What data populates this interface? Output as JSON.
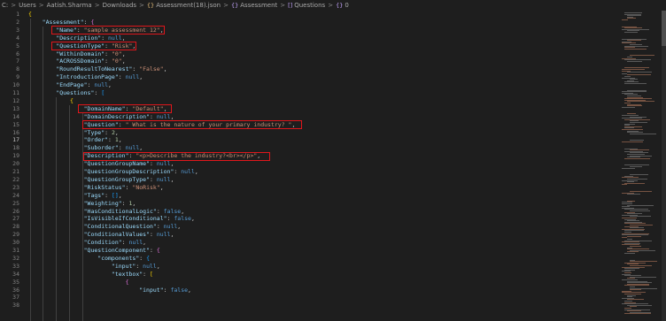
{
  "breadcrumb": {
    "items": [
      {
        "label": "C:",
        "icon": ""
      },
      {
        "label": "Users",
        "icon": ""
      },
      {
        "label": "Aatish.Sharma",
        "icon": ""
      },
      {
        "label": "Downloads",
        "icon": ""
      },
      {
        "label": "Assessment(18).json",
        "icon": "{}"
      },
      {
        "label": "Assessment",
        "icon": "{}"
      },
      {
        "label": "Questions",
        "icon": "[]"
      },
      {
        "label": "0",
        "icon": "{}"
      }
    ],
    "separator": ">"
  },
  "editor": {
    "active_line": 17,
    "lines": [
      {
        "n": "1"
      },
      {
        "n": "2"
      },
      {
        "n": "3"
      },
      {
        "n": "4"
      },
      {
        "n": "5"
      },
      {
        "n": "6"
      },
      {
        "n": "7"
      },
      {
        "n": "8"
      },
      {
        "n": "9"
      },
      {
        "n": "10"
      },
      {
        "n": "11"
      },
      {
        "n": "12"
      },
      {
        "n": "13"
      },
      {
        "n": "14"
      },
      {
        "n": "15"
      },
      {
        "n": "16"
      },
      {
        "n": "17"
      },
      {
        "n": "18"
      },
      {
        "n": "19"
      },
      {
        "n": "20"
      },
      {
        "n": "21"
      },
      {
        "n": "22"
      },
      {
        "n": "23"
      },
      {
        "n": "24"
      },
      {
        "n": "25"
      },
      {
        "n": "26"
      },
      {
        "n": "27"
      },
      {
        "n": "28"
      },
      {
        "n": "29"
      },
      {
        "n": "30"
      },
      {
        "n": "31"
      },
      {
        "n": "32"
      },
      {
        "n": "33"
      },
      {
        "n": "34"
      },
      {
        "n": "35"
      },
      {
        "n": "36"
      },
      {
        "n": "37"
      },
      {
        "n": "38"
      }
    ],
    "code": {
      "l2_key": "\"Assessment\"",
      "l3_key": "\"Name\"",
      "l3_val": "\"sample assessment 12\"",
      "l4_key": "\"Description\"",
      "l4_val": "null",
      "l5_key": "\"QuestionType\"",
      "l5_val": "\"Risk\"",
      "l6_key": "\"WithinDomain\"",
      "l6_val": "\"0\"",
      "l7_key": "\"ACROSSDomain\"",
      "l7_val": "\"0\"",
      "l8_key": "\"RoundResultToNearest\"",
      "l8_val": "\"False\"",
      "l9_key": "\"IntroductionPage\"",
      "l9_val": "null",
      "l10_key": "\"EndPage\"",
      "l10_val": "null",
      "l11_key": "\"Questions\"",
      "l13_key": "\"DomainName\"",
      "l13_val": "\"Default\"",
      "l14_key": "\"DomainDescription\"",
      "l14_val": "null",
      "l15_key": "\"Question\"",
      "l15_val": "\" What is the nature of your primary industry? \"",
      "l16_key": "\"Type\"",
      "l16_val": "2",
      "l17_key": "\"Order\"",
      "l17_val": "1",
      "l18_key": "\"Suborder\"",
      "l18_val": "null",
      "l19_key": "\"Description\"",
      "l19_val": "\"<p>Describe the industry?<br></p>\"",
      "l20_key": "\"QuestionGroupName\"",
      "l20_val": "null",
      "l21_key": "\"QuestionGroupDescription\"",
      "l21_val": "null",
      "l22_key": "\"QuestionGroupType\"",
      "l22_val": "null",
      "l23_key": "\"RiskStatus\"",
      "l23_val": "\"NoRisk\"",
      "l24_key": "\"Tags\"",
      "l24_val": "[]",
      "l25_key": "\"Weighting\"",
      "l25_val": "1",
      "l26_key": "\"HasConditionalLogic\"",
      "l26_val": "false",
      "l27_key": "\"IsVisibleIfConditional\"",
      "l27_val": "false",
      "l28_key": "\"ConditionalQuestion\"",
      "l28_val": "null",
      "l29_key": "\"ConditionalValues\"",
      "l29_val": "null",
      "l30_key": "\"Condition\"",
      "l30_val": "null",
      "l31_key": "\"QuestionComponent\"",
      "l32_key": "\"components\"",
      "l33_key": "\"input\"",
      "l33_val": "null",
      "l34_key": "\"textbox\"",
      "l36_key": "\"input\"",
      "l36_val": "false"
    }
  },
  "colors": {
    "background": "#1e1e1e",
    "json_key": "#9cdcfe",
    "json_string": "#ce9178",
    "json_number": "#b5cea8",
    "json_keyword": "#569cd6",
    "highlight_box": "#e0161b"
  }
}
